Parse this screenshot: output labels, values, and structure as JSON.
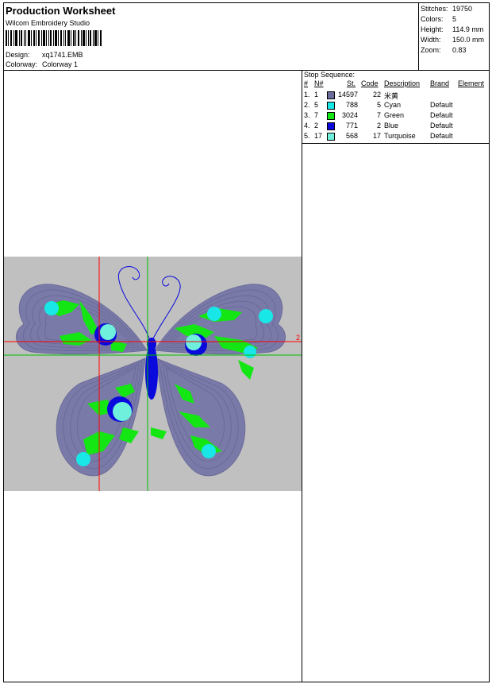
{
  "header": {
    "title": "Production Worksheet",
    "software": "Wilcom Embroidery Studio",
    "design_label": "Design:",
    "design_value": "xq1741.EMB",
    "colorway_label": "Colorway:",
    "colorway_value": "Colorway 1"
  },
  "stats": {
    "stitches_label": "Stitches:",
    "stitches_value": "19750",
    "colors_label": "Colors:",
    "colors_value": "5",
    "height_label": "Height:",
    "height_value": "114.9 mm",
    "width_label": "Width:",
    "width_value": "150.0 mm",
    "zoom_label": "Zoom:",
    "zoom_value": "0.83"
  },
  "stop_sequence": {
    "title": "Stop Sequence:",
    "headers": {
      "num": "#",
      "n": "N#",
      "st": "St.",
      "code": "Code",
      "description": "Description",
      "brand": "Brand",
      "element": "Element"
    },
    "rows": [
      {
        "num": "1.",
        "n": "1",
        "color": "#6b6b9b",
        "st": "14597",
        "code": "22",
        "description": "米黄",
        "brand": ""
      },
      {
        "num": "2.",
        "n": "5",
        "color": "#19e6e6",
        "st": "788",
        "code": "5",
        "description": "Cyan",
        "brand": "Default"
      },
      {
        "num": "3.",
        "n": "7",
        "color": "#14e614",
        "st": "3024",
        "code": "7",
        "description": "Green",
        "brand": "Default"
      },
      {
        "num": "4.",
        "n": "2",
        "color": "#0a0adc",
        "st": "771",
        "code": "2",
        "description": "Blue",
        "brand": "Default"
      },
      {
        "num": "5.",
        "n": "17",
        "color": "#6ef0dc",
        "st": "568",
        "code": "17",
        "description": "Turquoise",
        "brand": "Default"
      }
    ]
  },
  "design_view": {
    "background": "#c0c0c0",
    "wing_color": "#6b6b9b",
    "guide_red": "#ff0000",
    "guide_green": "#00c000",
    "marker_label": "2"
  }
}
